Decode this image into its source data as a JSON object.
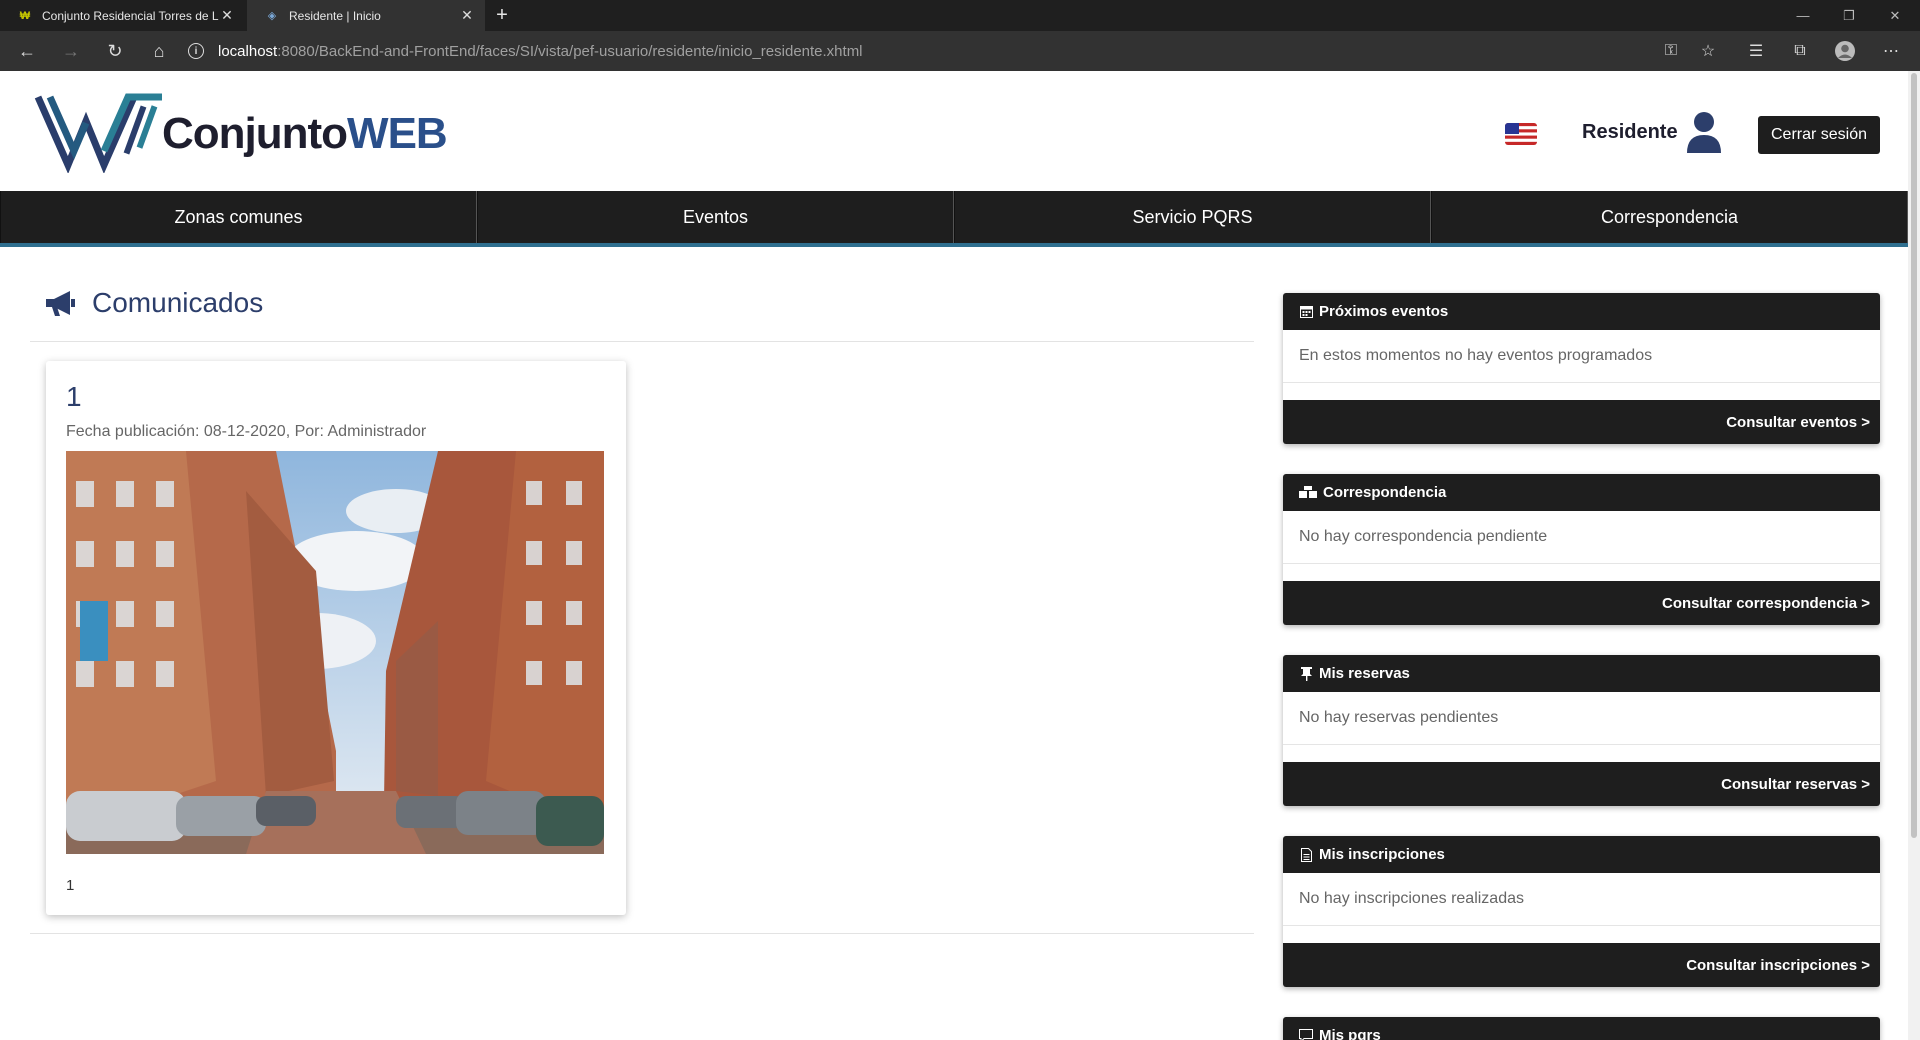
{
  "browser": {
    "tabs": [
      {
        "title": "Conjunto Residencial Torres de L",
        "active": false
      },
      {
        "title": "Residente | Inicio",
        "active": true
      }
    ],
    "url_host": "localhost",
    "url_path": ":8080/BackEnd-and-FrontEnd/faces/SI/vista/pef-usuario/residente/inicio_residente.xhtml"
  },
  "header": {
    "brand_part1": "Conjunto",
    "brand_part2": "WEB",
    "role": "Residente",
    "logout_label": "Cerrar sesión"
  },
  "nav": {
    "items": [
      "Zonas comunes",
      "Eventos",
      "Servicio PQRS",
      "Correspondencia"
    ]
  },
  "comunicados": {
    "title": "Comunicados",
    "posts": [
      {
        "number": "1",
        "meta": "Fecha publicación: 08-12-2020, Por: Administrador",
        "body": "1"
      }
    ]
  },
  "widgets": [
    {
      "title": "Próximos eventos",
      "icon": "calendar-icon",
      "message": "En estos momentos no hay eventos programados",
      "action": "Consultar eventos >"
    },
    {
      "title": "Correspondencia",
      "icon": "boxes-icon",
      "message": "No hay correspondencia pendiente",
      "action": "Consultar correspondencia >"
    },
    {
      "title": "Mis reservas",
      "icon": "pin-icon",
      "message": "No hay reservas pendientes",
      "action": "Consultar reservas >"
    },
    {
      "title": "Mis inscripciones",
      "icon": "document-icon",
      "message": "No hay inscripciones realizadas",
      "action": "Consultar inscripciones >"
    },
    {
      "title": "Mis pqrs",
      "icon": "comment-icon"
    }
  ],
  "colors": {
    "dark": "#1e1e1e",
    "brand_blue": "#2a4f8a",
    "accent_teal": "#2f6f8f",
    "heading": "#2c3e6b"
  }
}
